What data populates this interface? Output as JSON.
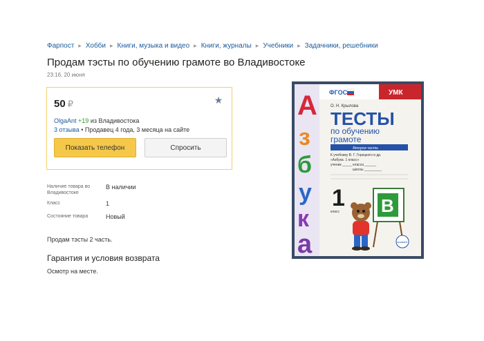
{
  "breadcrumb": [
    "Фарпост",
    "Хобби",
    "Книги, музыка и видео",
    "Книги, журналы",
    "Учебники",
    "Задачники, решебники"
  ],
  "title": "Продам тэсты по обучению грамоте во Владивостоке",
  "date": "23:16, 20 июня",
  "price": {
    "value": "50",
    "currency": "₽"
  },
  "seller": {
    "name": "OlgaAnt",
    "rating": "+19",
    "location": "из Владивостока",
    "reviews": "3 отзыва",
    "tenure": "• Продавец 4 года, 3 месяца на сайте"
  },
  "buttons": {
    "phone": "Показать телефон",
    "ask": "Спросить"
  },
  "properties": [
    {
      "key": "Наличие товара во Владивостоке",
      "value": "В наличии"
    },
    {
      "key": "Класс",
      "value": "1"
    },
    {
      "key": "Состояние товара",
      "value": "Новый"
    }
  ],
  "description": "Продам тэсты 2 часть.",
  "guarantee": {
    "title": "Гарантия и условия возврата",
    "text": "Осмотр на месте."
  },
  "book": {
    "fgos": "ФГОС",
    "umk": "УМК",
    "author": "О. Н. Крылова",
    "title_line1": "ТЕСТЫ",
    "title_line2": "по обучению",
    "title_line3": "грамоте",
    "part": "Вторая часть",
    "textbook": "К учебнику В. Г. Горецкого и др.",
    "textbook2": "«Азбука. 1 класс»",
    "student": "ученик _____ класса ______",
    "school": "школы _________",
    "grade": "1",
    "grade_label": "класс",
    "spine": [
      "А",
      "з",
      "б",
      "у",
      "к",
      "а"
    ],
    "board_letter": "В",
    "publisher": "экзамен"
  },
  "colors": {
    "link": "#1a5a9c",
    "accent": "#f6c84a",
    "rating": "#2a9a2a"
  }
}
